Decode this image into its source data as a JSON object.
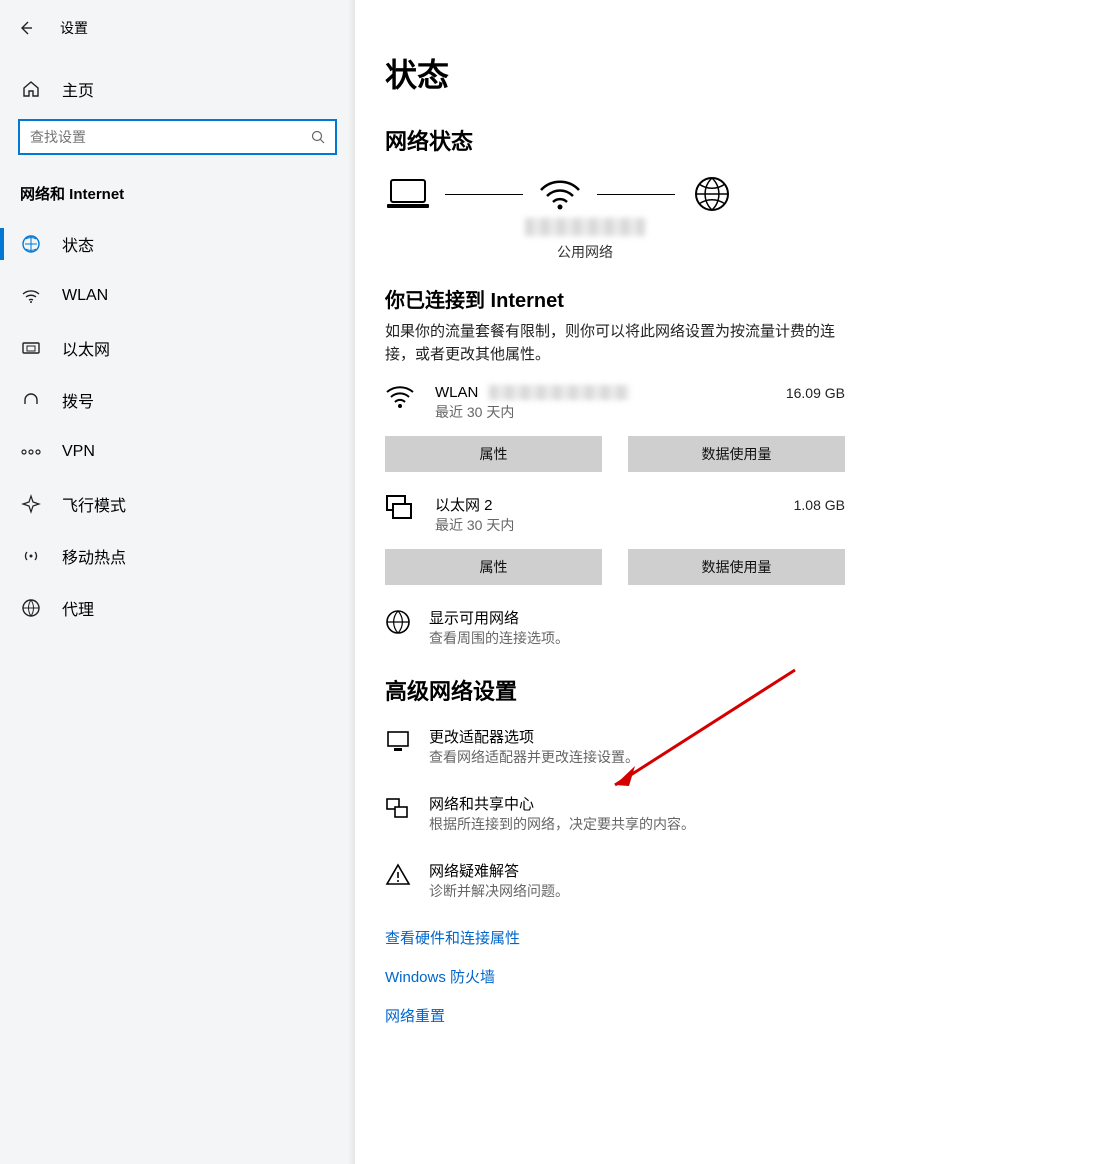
{
  "titlebar": {
    "title": "设置"
  },
  "sidebar": {
    "home": "主页",
    "search_placeholder": "查找设置",
    "group": "网络和 Internet",
    "items": [
      {
        "label": "状态"
      },
      {
        "label": "WLAN"
      },
      {
        "label": "以太网"
      },
      {
        "label": "拨号"
      },
      {
        "label": "VPN"
      },
      {
        "label": "飞行模式"
      },
      {
        "label": "移动热点"
      },
      {
        "label": "代理"
      }
    ]
  },
  "main": {
    "title": "状态",
    "net_status_heading": "网络状态",
    "public_network": "公用网络",
    "connected_heading": "你已连接到 Internet",
    "connected_desc": "如果你的流量套餐有限制，则你可以将此网络设置为按流量计费的连接，或者更改其他属性。",
    "connections": [
      {
        "name": "WLAN",
        "period": "最近 30 天内",
        "usage": "16.09 GB"
      },
      {
        "name": "以太网 2",
        "period": "最近 30 天内",
        "usage": "1.08 GB"
      }
    ],
    "btn_props": "属性",
    "btn_usage": "数据使用量",
    "show_networks": {
      "title": "显示可用网络",
      "desc": "查看周围的连接选项。"
    },
    "adv_heading": "高级网络设置",
    "adv_items": [
      {
        "title": "更改适配器选项",
        "desc": "查看网络适配器并更改连接设置。"
      },
      {
        "title": "网络和共享中心",
        "desc": "根据所连接到的网络，决定要共享的内容。"
      },
      {
        "title": "网络疑难解答",
        "desc": "诊断并解决网络问题。"
      }
    ],
    "links": [
      "查看硬件和连接属性",
      "Windows 防火墙",
      "网络重置"
    ]
  }
}
